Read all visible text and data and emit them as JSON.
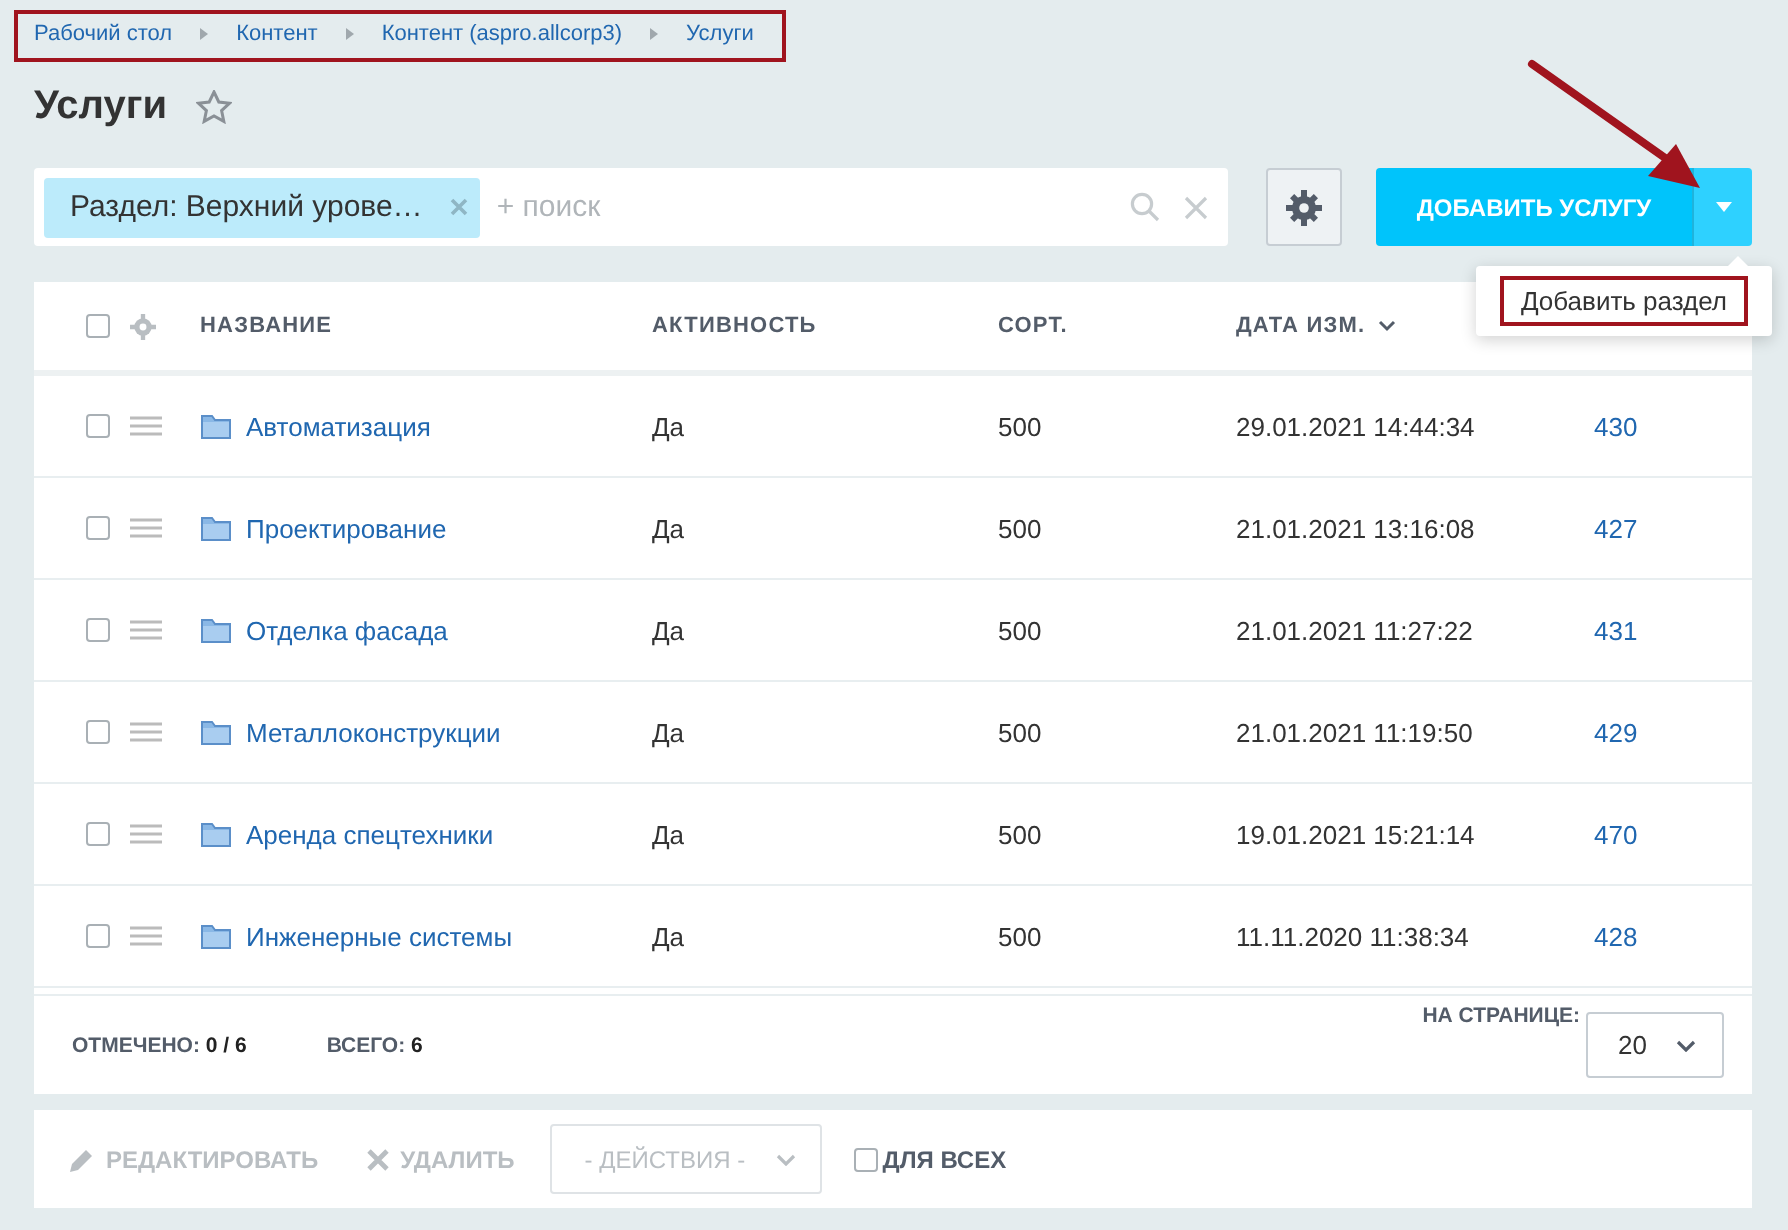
{
  "breadcrumbs": [
    "Рабочий стол",
    "Контент",
    "Контент (aspro.allcorp3)",
    "Услуги"
  ],
  "title": "Услуги",
  "filter": {
    "tag": "Раздел: Верхний урове…",
    "placeholder": "+ поиск"
  },
  "add_button": {
    "label": "ДОБАВИТЬ УСЛУГУ",
    "menu_open": true
  },
  "dropdown_menu": [
    {
      "label": "Добавить раздел"
    }
  ],
  "table": {
    "select_all": {
      "checked": false
    },
    "columns": [
      {
        "label": "НАЗВАНИЕ",
        "sorted": false
      },
      {
        "label": "АКТИВНОСТЬ",
        "sorted": false
      },
      {
        "label": "СОРТ.",
        "sorted": false
      },
      {
        "label": "ДАТА ИЗМ.",
        "sorted": true
      }
    ],
    "rows": [
      {
        "name": "Автоматизация",
        "active": "Да",
        "sort": "500",
        "date": "29.01.2021 14:44:34",
        "id": "430",
        "checked": false
      },
      {
        "name": "Проектирование",
        "active": "Да",
        "sort": "500",
        "date": "21.01.2021 13:16:08",
        "id": "427",
        "checked": false
      },
      {
        "name": "Отделка фасада",
        "active": "Да",
        "sort": "500",
        "date": "21.01.2021 11:27:22",
        "id": "431",
        "checked": false
      },
      {
        "name": "Металлоконструкции",
        "active": "Да",
        "sort": "500",
        "date": "21.01.2021 11:19:50",
        "id": "429",
        "checked": false
      },
      {
        "name": "Аренда спецтехники",
        "active": "Да",
        "sort": "500",
        "date": "19.01.2021 15:21:14",
        "id": "470",
        "checked": false
      },
      {
        "name": "Инженерные системы",
        "active": "Да",
        "sort": "500",
        "date": "11.11.2020 11:38:34",
        "id": "428",
        "checked": false
      }
    ]
  },
  "footer": {
    "marked_label": "ОТМЕЧЕНО:",
    "marked_value": "0 / 6",
    "total_label": "ВСЕГО:",
    "total_value": "6",
    "per_page_label": "НА СТРАНИЦЕ:",
    "per_page": "20"
  },
  "actions": {
    "edit": {
      "label": "РЕДАКТИРОВАТЬ",
      "disabled": true
    },
    "delete": {
      "label": "УДАЛИТЬ",
      "disabled": true
    },
    "select": "- ДЕЙСТВИЯ -",
    "for_all": {
      "label": "ДЛЯ ВСЕХ",
      "checked": false
    }
  }
}
